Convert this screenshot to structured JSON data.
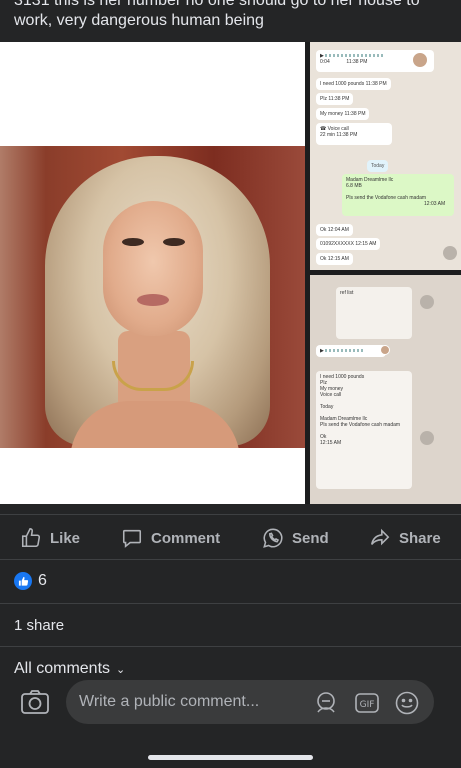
{
  "post": {
    "text_line1": "3131 this is her number no one should go to her house to",
    "text_line2": "work, very dangerous human being"
  },
  "chat_screenshot_1": {
    "voice_time_a": "0:04",
    "voice_time_b": "11:38 PM",
    "msg1": "I need 1000 pounds",
    "msg1_time": "11:38 PM",
    "msg2": "Plz",
    "msg2_time": "11:38 PM",
    "msg3": "My money",
    "msg3_time": "11:38 PM",
    "call_label": "Voice call",
    "call_sub": "22 min",
    "call_time": "11:38 PM",
    "day_label": "Today",
    "quote_name": "Madam Dreamlme llc",
    "quote_sub": "6.8 MB",
    "msg4": "Pls send the Vodafone cash madam",
    "msg4_time": "12:03 AM",
    "msg5": "Ok",
    "msg5_time": "12:04 AM",
    "msg6": "01092XXXXXX",
    "msg6_time": "12:15 AM",
    "msg7": "Ok",
    "msg7_time": "12:15 AM"
  },
  "chat_screenshot_2": {
    "doc_label": "ref list",
    "msg1": "I need 1000 pounds",
    "msg2": "Plz",
    "msg3": "My money",
    "call_label": "Voice call",
    "day_label": "Today",
    "quote_name": "Madam Dreamlme llc",
    "msg4": "Pls send the Vodafone cash madam",
    "msg5": "Ok",
    "time": "12:15 AM"
  },
  "actions": {
    "like": "Like",
    "comment": "Comment",
    "send": "Send",
    "share": "Share"
  },
  "reactions": {
    "count": "6"
  },
  "shares": {
    "label": "1 share"
  },
  "comments": {
    "all_label": "All comments",
    "chevron": "⌄"
  },
  "comment_box": {
    "placeholder": "Write a public comment...",
    "gif_label": "GIF"
  },
  "colors": {
    "background": "#242526",
    "like_blue": "#1877f2",
    "muted_text": "#b0b3b8"
  }
}
